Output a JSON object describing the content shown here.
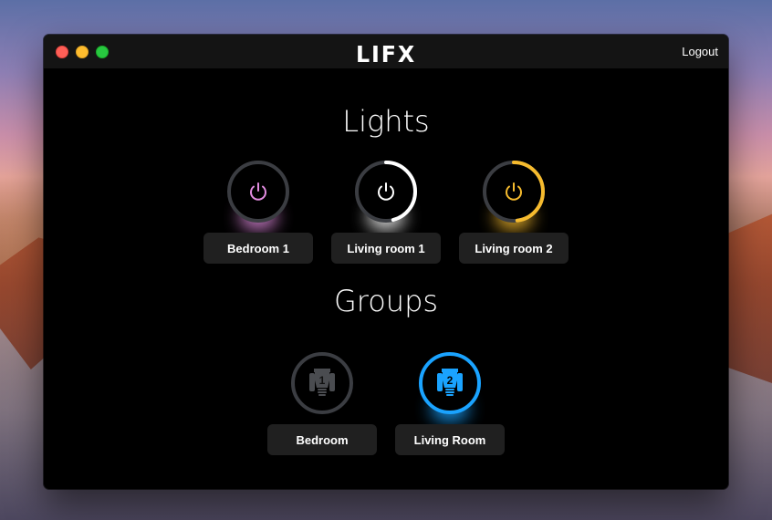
{
  "window": {
    "brand": "LIFX",
    "logout_label": "Logout"
  },
  "lights": {
    "title": "Lights",
    "items": [
      {
        "label": "Bedroom 1",
        "level": 0.0,
        "color": "#e28ce0",
        "icon": "power-icon"
      },
      {
        "label": "Living room 1",
        "level": 0.46,
        "color": "#ffffff",
        "icon": "power-icon"
      },
      {
        "label": "Living room 2",
        "level": 0.48,
        "color": "#f6bb2e",
        "icon": "power-icon"
      }
    ]
  },
  "groups": {
    "title": "Groups",
    "items": [
      {
        "label": "Bedroom",
        "number": "1",
        "active": false,
        "color": "#3a3a3a",
        "icon": "bulb-group-icon"
      },
      {
        "label": "Living Room",
        "number": "2",
        "active": true,
        "color": "#1aa3ff",
        "icon": "bulb-group-icon"
      }
    ]
  },
  "colors": {
    "ring_track": "#3b3d42",
    "label_bg": "#202020"
  }
}
